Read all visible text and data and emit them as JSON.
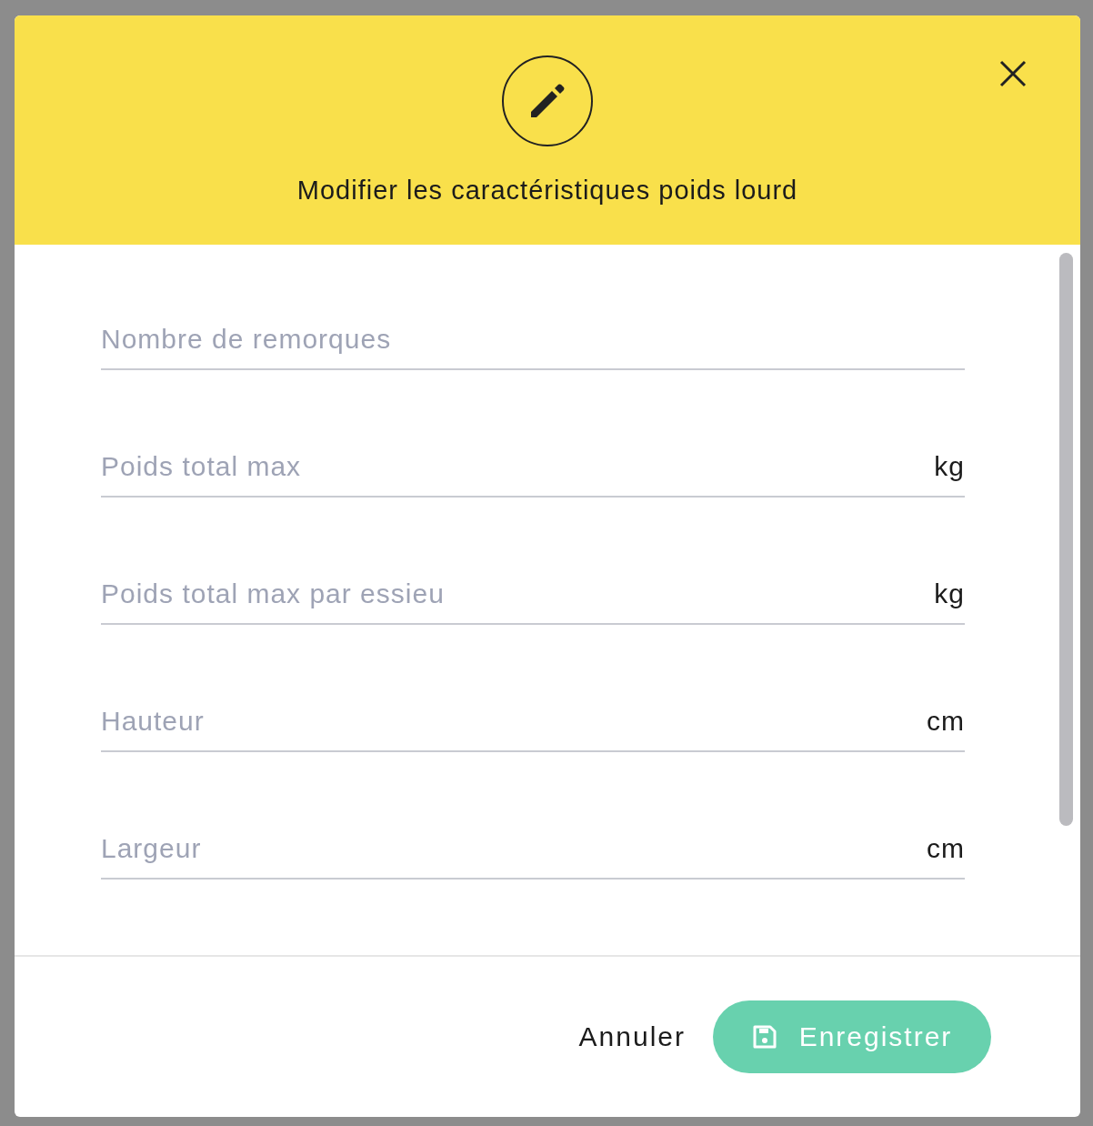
{
  "dialog": {
    "title": "Modifier les caractéristiques poids lourd",
    "fields": [
      {
        "placeholder": "Nombre de remorques"
      },
      {
        "placeholder": "Poids total max",
        "unit": "kg"
      },
      {
        "placeholder": "Poids total max par essieu",
        "unit": "kg"
      },
      {
        "placeholder": "Hauteur",
        "unit": "cm"
      },
      {
        "placeholder": "Largeur",
        "unit": "cm"
      }
    ],
    "buttons": [
      {
        "label": "Annuler",
        "kind": "text"
      },
      {
        "label": "Enregistrer",
        "kind": "primary"
      }
    ]
  }
}
